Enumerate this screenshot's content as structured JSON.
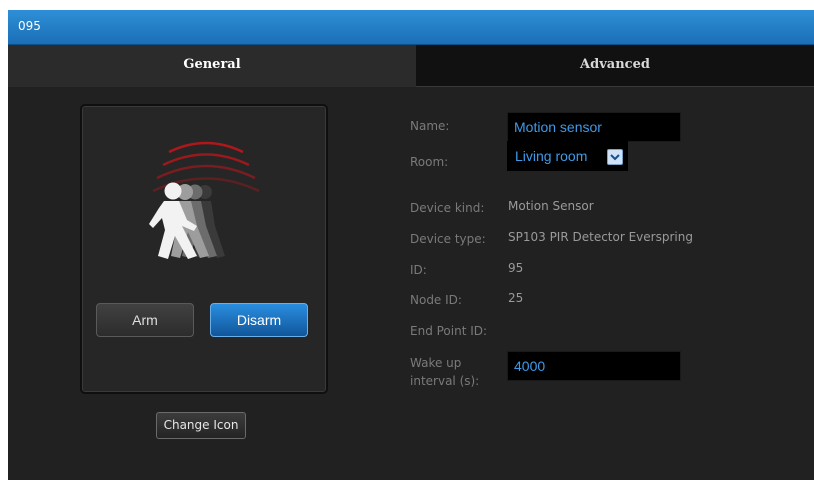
{
  "window": {
    "title": "095"
  },
  "tabs": {
    "general": "General",
    "advanced": "Advanced"
  },
  "icon_panel": {
    "icon": "motion-sensor-walking-person-icon",
    "arm_label": "Arm",
    "disarm_label": "Disarm",
    "change_icon_label": "Change Icon"
  },
  "form": {
    "name_label": "Name:",
    "name_value": "Motion sensor",
    "room_label": "Room:",
    "room_value": "Living room",
    "device_kind_label": "Device kind:",
    "device_kind_value": "Motion Sensor",
    "device_type_label": "Device type:",
    "device_type_value": "SP103 PIR Detector Everspring",
    "id_label": "ID:",
    "id_value": "95",
    "node_id_label": "Node ID:",
    "node_id_value": "25",
    "end_point_id_label": "End Point ID:",
    "end_point_id_value": "",
    "wakeup_label_line1": "Wake up",
    "wakeup_label_line2": "interval (s):",
    "wakeup_value": "4000"
  },
  "colors": {
    "accent": "#1b6fb7",
    "field_text": "#3f9ae8",
    "wave_red": "#c0161b",
    "panel_bg": "#212121"
  }
}
